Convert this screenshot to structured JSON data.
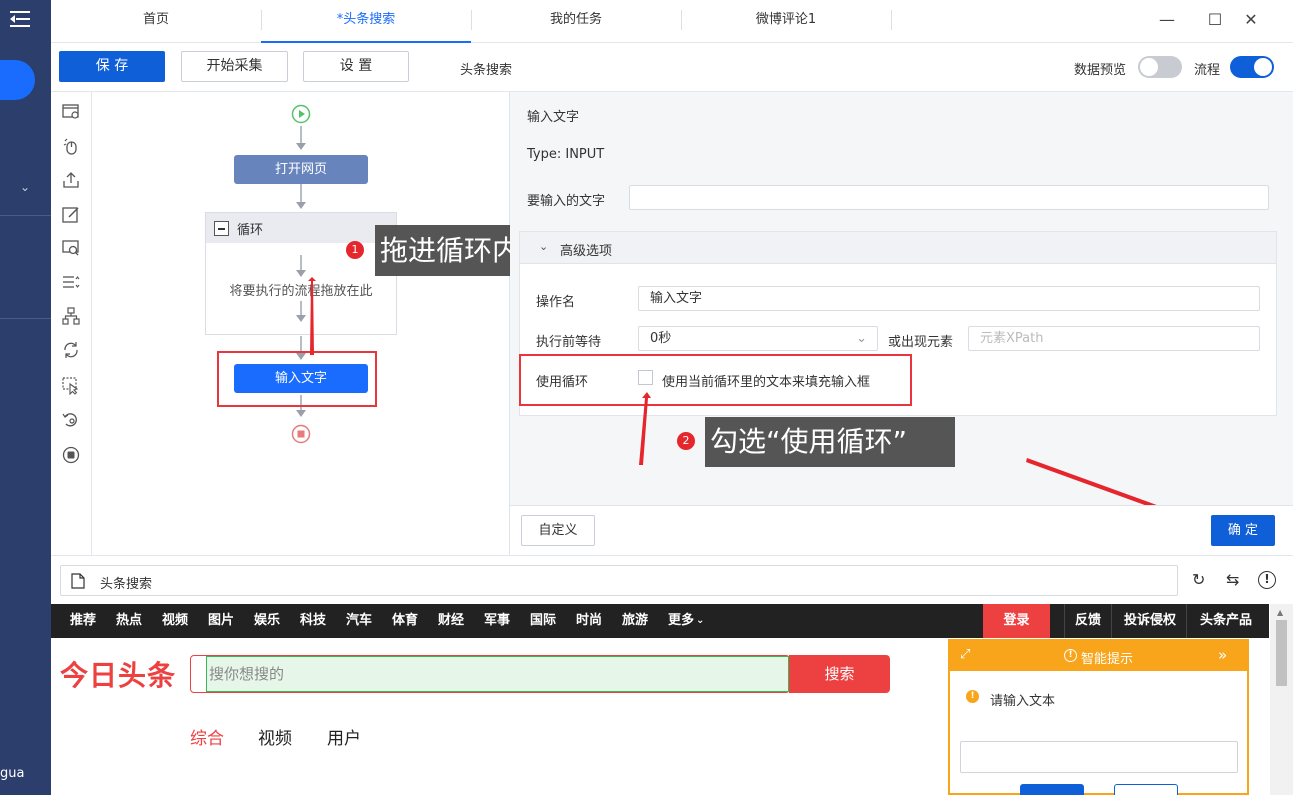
{
  "rail": {
    "user_text": "gua"
  },
  "tabs": [
    {
      "label": "首页"
    },
    {
      "label": "*头条搜索"
    },
    {
      "label": "我的任务"
    },
    {
      "label": "微博评论1"
    }
  ],
  "toolbar": {
    "save_label": "保 存",
    "start_label": "开始采集",
    "settings_label": "设 置",
    "task_name": "头条搜索",
    "preview_label": "数据预览",
    "flow_label": "流程"
  },
  "flow": {
    "open_page": "打开网页",
    "loop_title": "循环",
    "loop_placeholder": "将要执行的流程拖放在此",
    "input_text": "输入文字"
  },
  "config": {
    "title": "输入文字",
    "type": "Type: INPUT",
    "text_label": "要输入的文字",
    "text_value": "",
    "advanced_label": "高级选项",
    "op_name_label": "操作名",
    "op_name_value": "输入文字",
    "wait_label": "执行前等待",
    "wait_value": "0秒",
    "or_appear_label": "或出现元素",
    "xpath_placeholder": "元素XPath",
    "use_loop_label": "使用循环",
    "use_loop_checkbox_label": "使用当前循环里的文本来填充输入框",
    "custom_label": "自定义",
    "ok_label": "确 定"
  },
  "urlbar": {
    "title": "头条搜索"
  },
  "browser": {
    "nav": [
      "推荐",
      "热点",
      "视频",
      "图片",
      "娱乐",
      "科技",
      "汽车",
      "体育",
      "财经",
      "军事",
      "国际",
      "时尚",
      "旅游",
      "更多"
    ],
    "login": "登录",
    "right_links": [
      "反馈",
      "投诉侵权",
      "头条产品"
    ],
    "logo": "今日头条",
    "search_placeholder": "搜你想搜的",
    "search_button": "搜索",
    "result_tabs": [
      "综合",
      "视频",
      "用户"
    ],
    "tip_title": "智能提示",
    "tip_text": "请输入文本"
  },
  "annotations": {
    "step1_num": "1",
    "step1_text": "拖进循环内",
    "step2_num": "2",
    "step2_text": "勾选“使用循环”"
  },
  "colors": {
    "primary": "#0f5fd8",
    "rail": "#2c3e6b",
    "annotation_red": "#e8363c",
    "toutiao_red": "#ed4040",
    "tip_orange": "#f8a51b"
  }
}
